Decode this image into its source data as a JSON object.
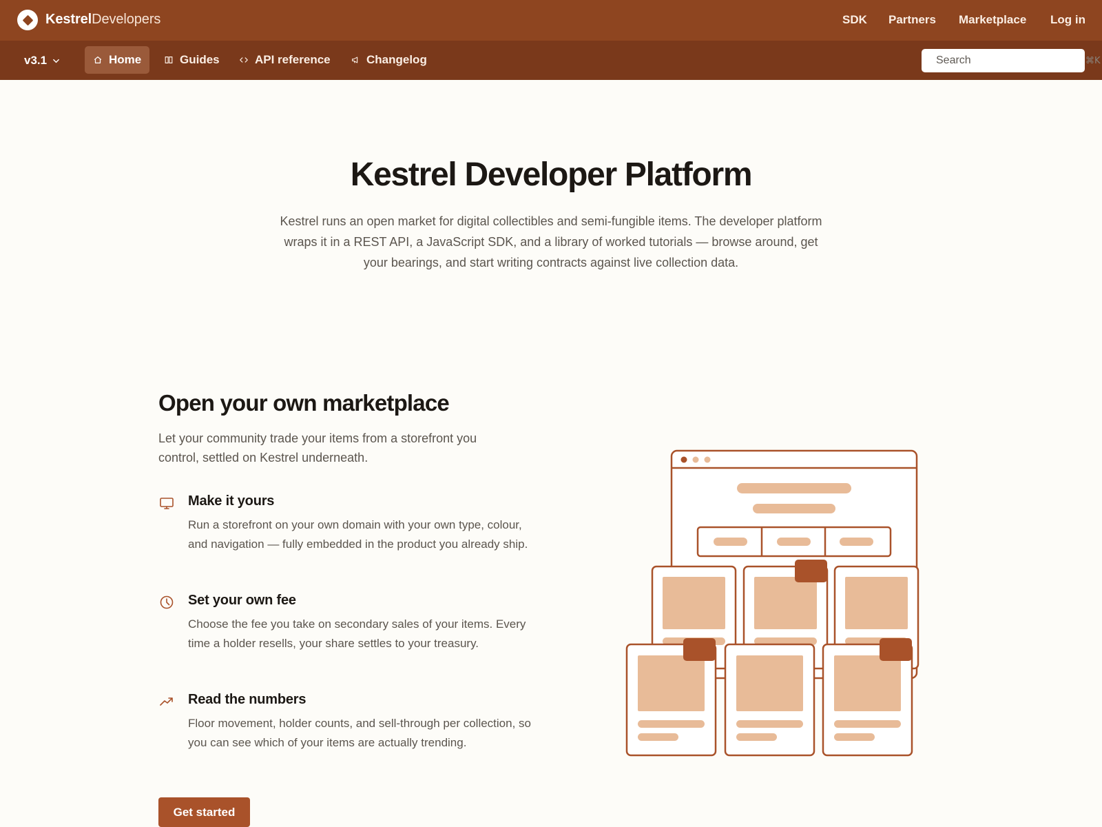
{
  "topbar": {
    "brand_bold": "Kestrel",
    "brand_light": "Developers",
    "links": [
      "SDK",
      "Partners",
      "Marketplace",
      "Log in"
    ]
  },
  "subnav": {
    "version": "v3.1",
    "tabs": [
      {
        "label": "Home",
        "icon": "home-icon",
        "active": true
      },
      {
        "label": "Guides",
        "icon": "book-icon",
        "active": false
      },
      {
        "label": "API reference",
        "icon": "code-icon",
        "active": false
      },
      {
        "label": "Changelog",
        "icon": "megaphone-icon",
        "active": false
      }
    ],
    "search": {
      "placeholder": "Search",
      "shortcut": "⌘K"
    }
  },
  "hero": {
    "title": "Kestrel Developer Platform",
    "subtitle": "Kestrel runs an open market for digital collectibles and semi-fungible items. The developer platform wraps it in a REST API, a JavaScript SDK, and a library of worked tutorials — browse around, get your bearings, and start writing contracts against live collection data."
  },
  "section": {
    "title": "Open your own marketplace",
    "subtitle": "Let your community trade your items from a storefront you control, settled on Kestrel underneath.",
    "features": [
      {
        "icon": "monitor-icon",
        "title": "Make it yours",
        "desc": "Run a storefront on your own domain with your own type, colour, and navigation — fully embedded in the product you already ship."
      },
      {
        "icon": "clock-icon",
        "title": "Set your own fee",
        "desc": "Choose the fee you take on secondary sales of your items. Every time a holder resells, your share settles to your treasury."
      },
      {
        "icon": "trending-up-icon",
        "title": "Read the numbers",
        "desc": "Floor movement, holder counts, and sell-through per collection, so you can see which of your items are actually trending."
      }
    ],
    "cta": "Get started"
  },
  "colors": {
    "topbar": "#8e4520",
    "subnav": "#7a391b",
    "accent": "#a9522a",
    "illustration_stroke": "#a9522a",
    "illustration_fill": "#e8bb98",
    "illustration_dark": "#a9522a"
  }
}
